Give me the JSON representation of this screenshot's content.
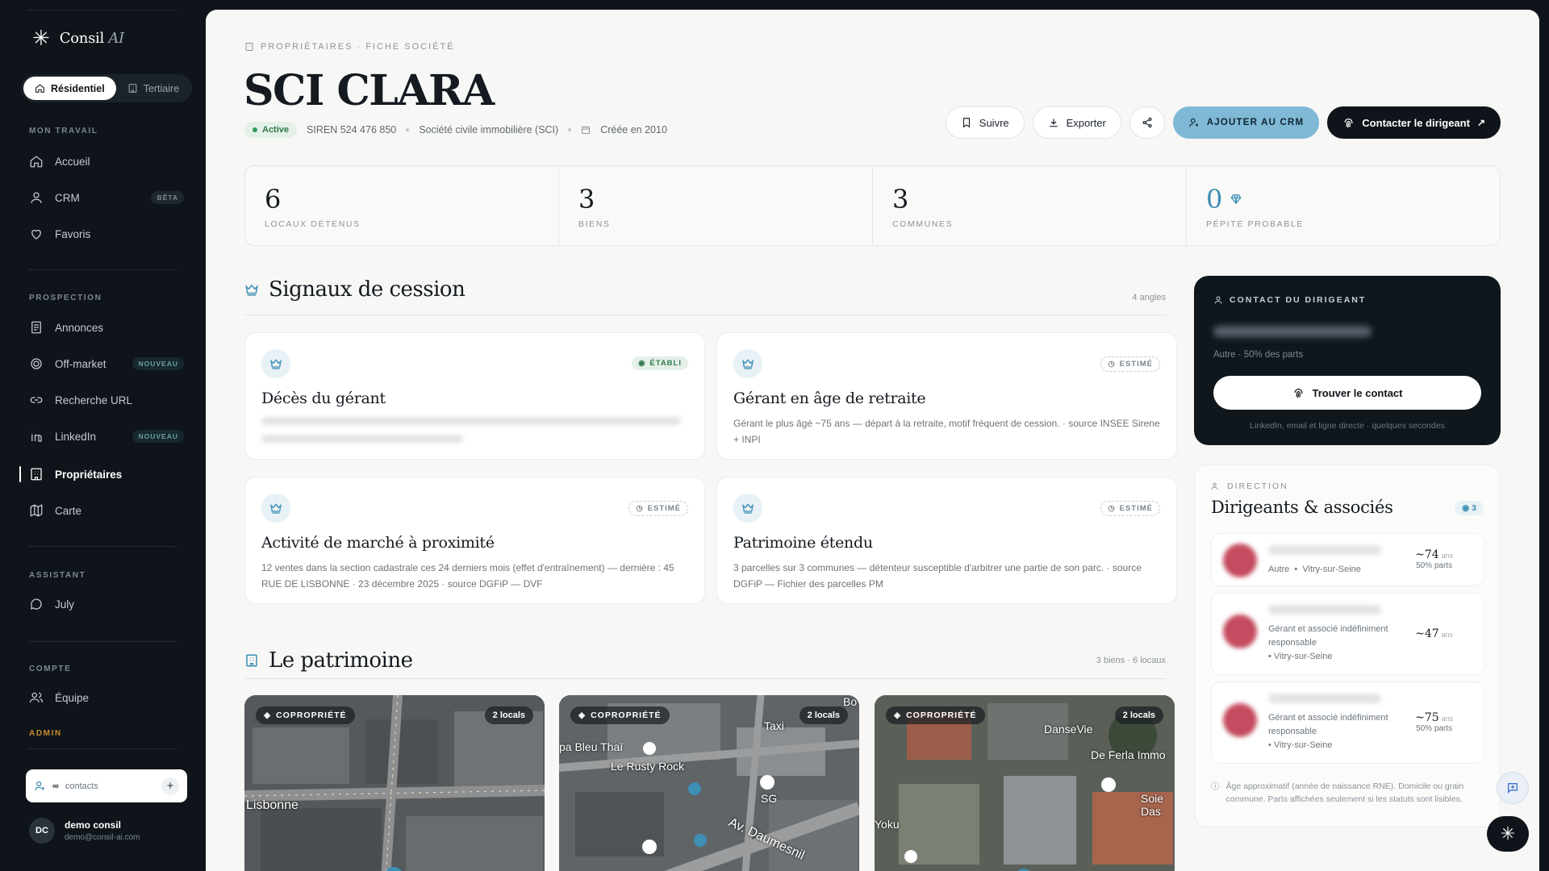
{
  "sidebar": {
    "brand": {
      "name": "Consil",
      "suffix": "AI"
    },
    "segment": {
      "residential": "Résidentiel",
      "tertiary": "Tertiaire"
    },
    "sections": {
      "work": "MON TRAVAIL",
      "prospection": "PROSPECTION",
      "assistant": "ASSISTANT",
      "account": "COMPTE",
      "admin": "ADMIN"
    },
    "items": {
      "accueil": "Accueil",
      "crm": "CRM",
      "crm_badge": "BÊTA",
      "favoris": "Favoris",
      "annonces": "Annonces",
      "offmarket": "Off-market",
      "offmarket_badge": "NOUVEAU",
      "recherche": "Recherche URL",
      "linkedin": "LinkedIn",
      "linkedin_badge": "NOUVEAU",
      "proprietaires": "Propriétaires",
      "carte": "Carte",
      "july": "July",
      "equipe": "Équipe"
    },
    "contacts": {
      "count": "∞",
      "label": "contacts"
    },
    "user": {
      "initials": "DC",
      "name": "demo consil",
      "email": "demo@consil-ai.com"
    }
  },
  "header": {
    "breadcrumb": "PROPRIÉTAIRES · FICHE SOCIÉTÉ",
    "title": "SCI CLARA",
    "status": "Active",
    "siren": "SIREN 524 476 850",
    "legal_form": "Société civile immobilière (SCI)",
    "created": "Créée en 2010",
    "actions": {
      "follow": "Suivre",
      "export": "Exporter",
      "add_crm": "AJOUTER AU CRM",
      "contact": "Contacter le dirigeant"
    }
  },
  "stats": [
    {
      "value": "6",
      "label": "LOCAUX DÉTENUS"
    },
    {
      "value": "3",
      "label": "BIENS"
    },
    {
      "value": "3",
      "label": "COMMUNES"
    },
    {
      "value": "0",
      "label": "PÉPITE PROBABLE"
    }
  ],
  "signals": {
    "title": "Signaux de cession",
    "count": "4 angles",
    "cards": [
      {
        "title": "Décès du gérant",
        "tag": "ÉTABLI",
        "desc": ""
      },
      {
        "title": "Gérant en âge de retraite",
        "tag": "ESTIMÉ",
        "desc": "Gérant le plus âgé ~75 ans — départ à la retraite, motif fréquent de cession. · source INSEE Sirene + INPI"
      },
      {
        "title": "Activité de marché à proximité",
        "tag": "ESTIMÉ",
        "desc": "12 ventes dans la section cadastrale ces 24 derniers mois (effet d'entraînement) — dernière : 45 RUE DE LISBONNE · 23 décembre 2025 · source DGFiP — DVF"
      },
      {
        "title": "Patrimoine étendu",
        "tag": "ESTIMÉ",
        "desc": "3 parcelles sur 3 communes — détenteur susceptible d'arbitrer une partie de son parc. · source DGFiP — Fichier des parcelles PM"
      }
    ]
  },
  "patrimoine": {
    "title": "Le patrimoine",
    "count": "3 biens · 6 locaux",
    "properties": [
      {
        "type": "COPROPRIÉTÉ",
        "locals": "2 locals",
        "labels": [
          "Lisbonne"
        ]
      },
      {
        "type": "COPROPRIÉTÉ",
        "locals": "2 locals",
        "labels": [
          "pa Bleu Thaï",
          "Le Rusty Rock",
          "Taxi",
          "SG",
          "Av. Daumesnil",
          "Bo"
        ]
      },
      {
        "type": "COPROPRIÉTÉ",
        "locals": "2 locals",
        "labels": [
          "DanseVie",
          "De Ferla Immo",
          "Soie Das",
          "Yoku"
        ]
      }
    ]
  },
  "contact_card": {
    "header": "CONTACT DU DIRIGEANT",
    "subtitle": "Autre · 50% des parts",
    "find": "Trouver le contact",
    "note": "LinkedIn, email et ligne directe · quelques secondes"
  },
  "direction": {
    "header": "DIRECTION",
    "title": "Dirigeants & associés",
    "count": "3",
    "people": [
      {
        "role": "Autre",
        "city": "Vitry-sur-Seine",
        "age": "~74",
        "unit": "ans",
        "parts": "50% parts"
      },
      {
        "role": "Gérant et associé indéfiniment responsable",
        "city": "Vitry-sur-Seine",
        "age": "~47",
        "unit": "ans",
        "parts": ""
      },
      {
        "role": "Gérant et associé indéfiniment responsable",
        "city": "Vitry-sur-Seine",
        "age": "~75",
        "unit": "ans",
        "parts": "50% parts"
      }
    ],
    "footnote": "Âge approximatif (année de naissance RNE). Domicile ou grain commune. Parts affichées seulement si les statuts sont lisibles."
  }
}
